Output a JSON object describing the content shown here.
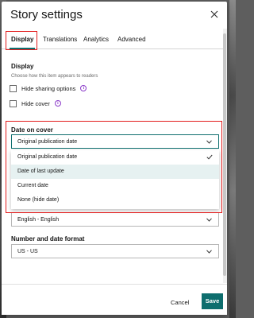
{
  "dialog": {
    "title": "Story settings"
  },
  "tabs": [
    {
      "label": "Display"
    },
    {
      "label": "Translations"
    },
    {
      "label": "Analytics"
    },
    {
      "label": "Advanced"
    }
  ],
  "display": {
    "heading": "Display",
    "description": "Choose how this item appears to readers",
    "hide_sharing_label": "Hide sharing options",
    "hide_cover_label": "Hide cover",
    "info_glyph": "i"
  },
  "date_on_cover": {
    "label": "Date on cover",
    "selected": "Original publication date",
    "options": [
      "Original publication date",
      "Date of last update",
      "Current date",
      "None (hide date)"
    ]
  },
  "language": {
    "selected": "English - English"
  },
  "number_date_format": {
    "label": "Number and date format",
    "selected": "US - US"
  },
  "footer": {
    "cancel_label": "Cancel",
    "save_label": "Save"
  },
  "colors": {
    "accent": "#0e6e6e",
    "highlight": "#e31c1c",
    "info": "#8b3bc9"
  },
  "icons": {
    "close": "close-icon",
    "chevron": "chevron-down-icon",
    "check": "check-icon",
    "info": "info-icon"
  }
}
